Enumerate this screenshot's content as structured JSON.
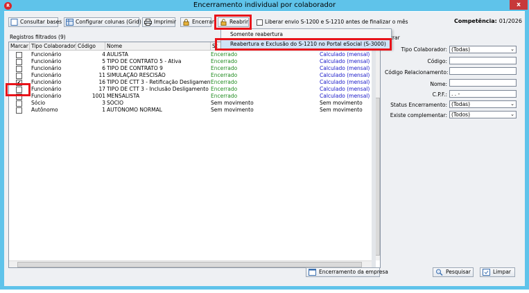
{
  "window": {
    "title": "Encerramento individual por colaborador",
    "close_label": "x"
  },
  "toolbar": {
    "consultar": "Consultar bases",
    "configurar": "Configurar colunas (Grid)",
    "imprimir": "Imprimir",
    "encerrar": "Encerrar",
    "reabrir": "Reabrir",
    "liberar": "Liberar envio S-1200 e S-1210 antes de finalizar o mês"
  },
  "competencia": {
    "label": "Competência:",
    "value": "01/2026"
  },
  "grid": {
    "count_label": "Registros filtrados (9)",
    "columns": [
      "Marcar",
      "Tipo Colaborador",
      "Código",
      "Nome",
      "St"
    ],
    "rows": [
      {
        "checked": false,
        "tipo": "Funcionário",
        "codigo": "4",
        "nome": "AULISTA",
        "status": "Encerrado",
        "calc": "Calculado (mensal)"
      },
      {
        "checked": false,
        "tipo": "Funcionário",
        "codigo": "5",
        "nome": "TIPO DE CONTRATO 5 - Ativa",
        "status": "Encerrado",
        "calc": "Calculado (mensal)"
      },
      {
        "checked": false,
        "tipo": "Funcionário",
        "codigo": "6",
        "nome": "TIPO DE CONTRATO 9",
        "status": "Encerrado",
        "calc": "Calculado (mensal)"
      },
      {
        "checked": false,
        "tipo": "Funcionário",
        "codigo": "11",
        "nome": "SIMULAÇÃO RESCISÃO",
        "status": "Encerrado",
        "calc": "Calculado (mensal)"
      },
      {
        "checked": true,
        "tipo": "Funcionário",
        "codigo": "16",
        "nome": "TIPO DE CTT 3 - Retificação Desligamento",
        "status": "Encerrado",
        "calc": "Calculado (mensal)"
      },
      {
        "checked": false,
        "tipo": "Funcionário",
        "codigo": "17",
        "nome": "TIPO DE CTT 3 - Inclusão Desligamento",
        "status": "Encerrado",
        "calc": "Calculado (mensal)"
      },
      {
        "checked": false,
        "tipo": "Funcionário",
        "codigo": "1001",
        "nome": "MENSALISTA",
        "status": "Encerrado",
        "calc": "Calculado (mensal)"
      },
      {
        "checked": false,
        "tipo": "Sócio",
        "codigo": "3",
        "nome": "SÓCIO",
        "status": "Sem movimento",
        "calc": "Sem movimento"
      },
      {
        "checked": false,
        "tipo": "Autônomo",
        "codigo": "1",
        "nome": "AUTÔNOMO NORMAL",
        "status": "Sem movimento",
        "calc": "Sem movimento"
      }
    ]
  },
  "dropdown": {
    "items": [
      "Somente reabertura",
      "Reabertura e Exclusão do S-1210 no Portal eSocial (S-3000)"
    ]
  },
  "filters": {
    "header": "trar",
    "tipo_colaborador_label": "Tipo Colaborador:",
    "tipo_colaborador_value": "(Todas)",
    "codigo_label": "Código:",
    "codigo_relacionamento_label": "Código Relacionamento:",
    "nome_label": "Nome:",
    "cpf_label": "C.P.F.:",
    "cpf_value": ". . -",
    "status_label": "Status Encerramento:",
    "status_value": "(Todas)",
    "complementar_label": "Existe complementar:",
    "complementar_value": "(Todos)"
  },
  "bottom": {
    "encerramento_empresa": "Encerramento da empresa",
    "pesquisar": "Pesquisar",
    "limpar": "Limpar"
  },
  "colors": {
    "titlebar": "#5fc3ea",
    "highlight": "#e8141a",
    "status_green": "#1e8a1e",
    "calc_blue": "#1515c8"
  }
}
